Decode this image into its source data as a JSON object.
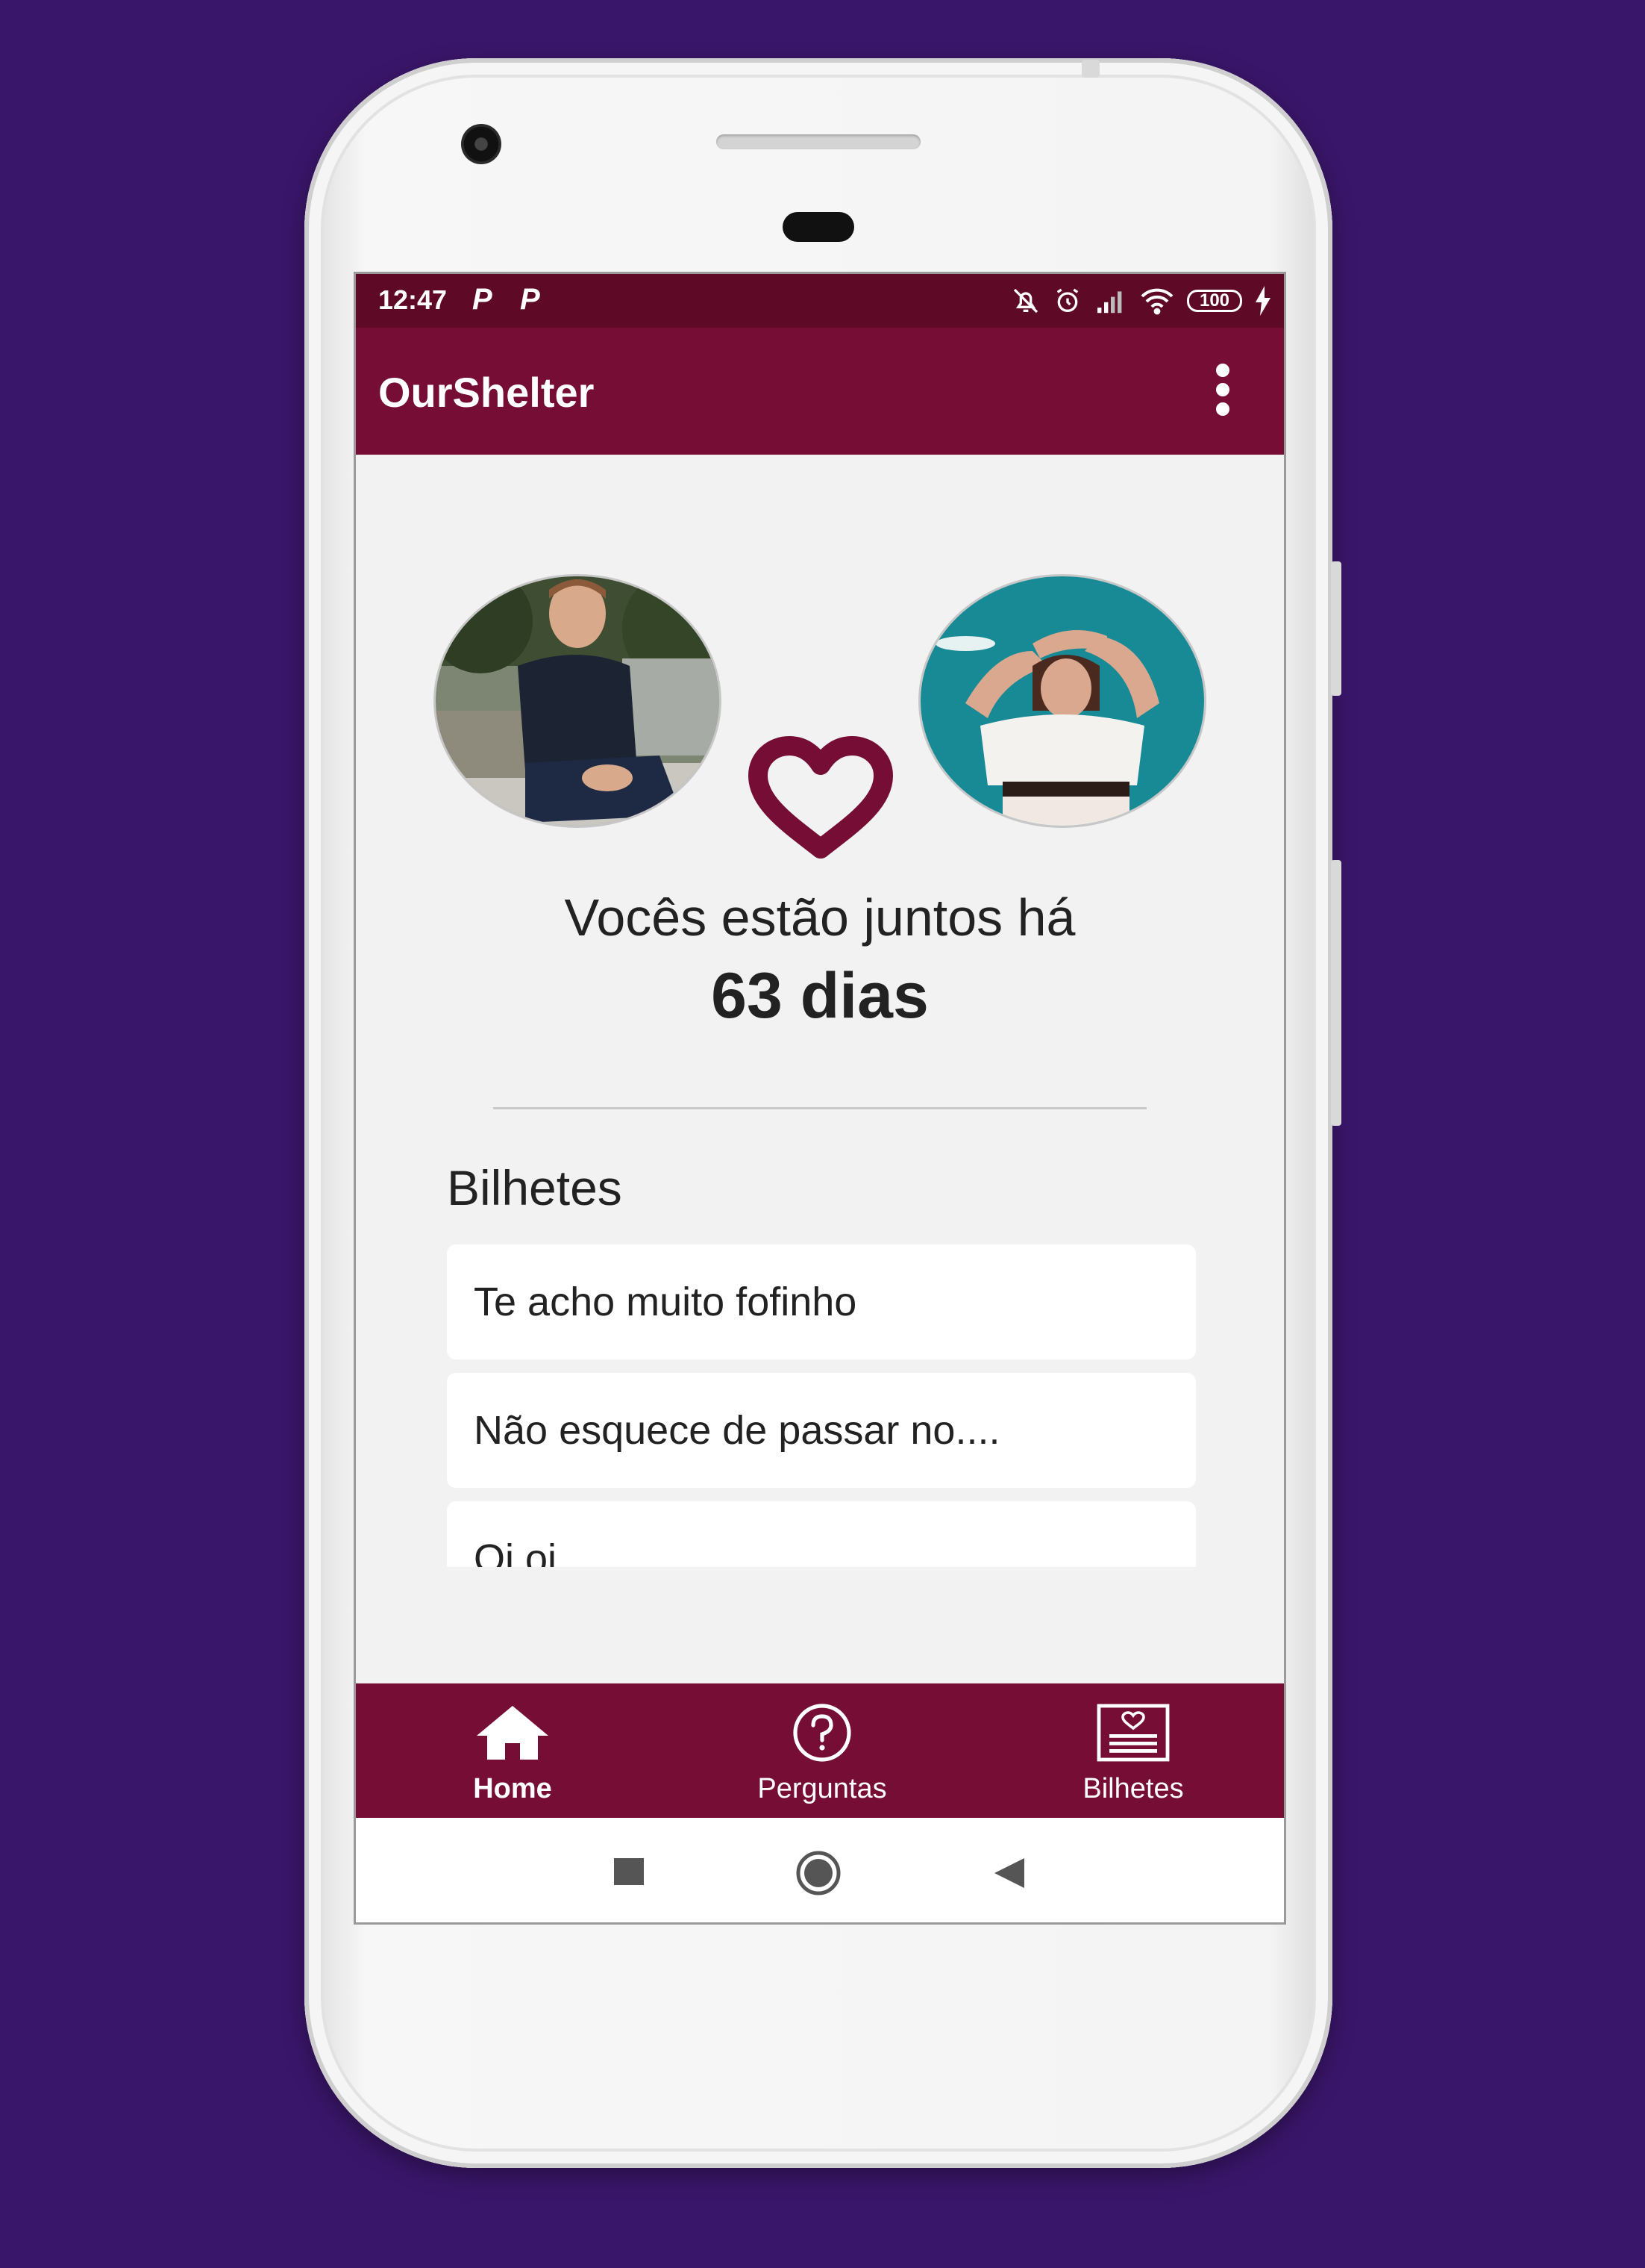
{
  "statusbar": {
    "time": "12:47",
    "notif_1": "P",
    "notif_2": "P",
    "battery": "100"
  },
  "appbar": {
    "title": "OurShelter",
    "menu_icon": "more-vert-icon"
  },
  "couple": {
    "line1": "Vocês estão juntos há",
    "days": "63 dias"
  },
  "notes": {
    "title": "Bilhetes",
    "items": [
      "Te acho muito fofinho",
      "Não esquece de passar no....",
      "Oi oi"
    ]
  },
  "bottom_nav": {
    "items": [
      {
        "label": "Home",
        "icon": "home-icon",
        "active": true
      },
      {
        "label": "Perguntas",
        "icon": "question-circle-icon",
        "active": false
      },
      {
        "label": "Bilhetes",
        "icon": "note-heart-icon",
        "active": false
      }
    ]
  },
  "colors": {
    "background": "#3a166a",
    "primary": "#750d35",
    "primary_dark": "#5e0a27",
    "screen": "#f2f2f2"
  }
}
